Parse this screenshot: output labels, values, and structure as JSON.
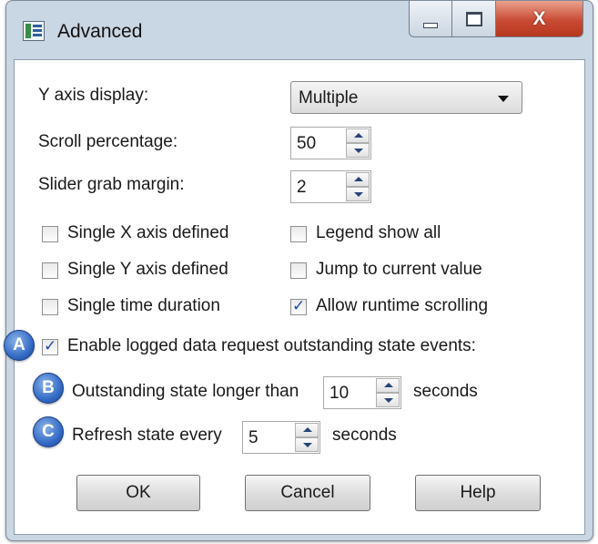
{
  "window": {
    "title": "Advanced",
    "close_glyph": "X"
  },
  "fields": {
    "y_axis_display": {
      "label": "Y axis display:",
      "value": "Multiple"
    },
    "scroll_percentage": {
      "label": "Scroll percentage:",
      "value": "50"
    },
    "slider_grab_margin": {
      "label": "Slider grab margin:",
      "value": "2"
    }
  },
  "checkboxes": {
    "single_x_axis": {
      "label": "Single X axis defined",
      "checked": false
    },
    "single_y_axis": {
      "label": "Single Y axis defined",
      "checked": false
    },
    "single_time_duration": {
      "label": "Single time duration",
      "checked": false
    },
    "legend_show_all": {
      "label": "Legend show all",
      "checked": false
    },
    "jump_to_current": {
      "label": "Jump to current value",
      "checked": false
    },
    "allow_runtime_scrolling": {
      "label": "Allow runtime scrolling",
      "checked": true
    },
    "enable_logged_data": {
      "label": "Enable logged data request outstanding state events:",
      "checked": true
    }
  },
  "outstanding": {
    "label": "Outstanding state longer than",
    "value": "10",
    "unit": "seconds"
  },
  "refresh": {
    "label": "Refresh state every",
    "value": "5",
    "unit": "seconds"
  },
  "callouts": {
    "a": "A",
    "b": "B",
    "c": "C"
  },
  "buttons": {
    "ok": "OK",
    "cancel": "Cancel",
    "help": "Help"
  },
  "icons": {
    "app": "chart-window-icon",
    "minimize": "minimize-icon",
    "maximize": "maximize-icon",
    "close": "close-icon",
    "dropdown": "chevron-down-icon",
    "spin_up": "arrow-up-icon",
    "spin_down": "arrow-down-icon"
  },
  "colors": {
    "frame": "#c9d6e3",
    "close_button": "#c94b33",
    "callout_badge": "#2f66c2",
    "checkmark": "#1c4fa1"
  }
}
